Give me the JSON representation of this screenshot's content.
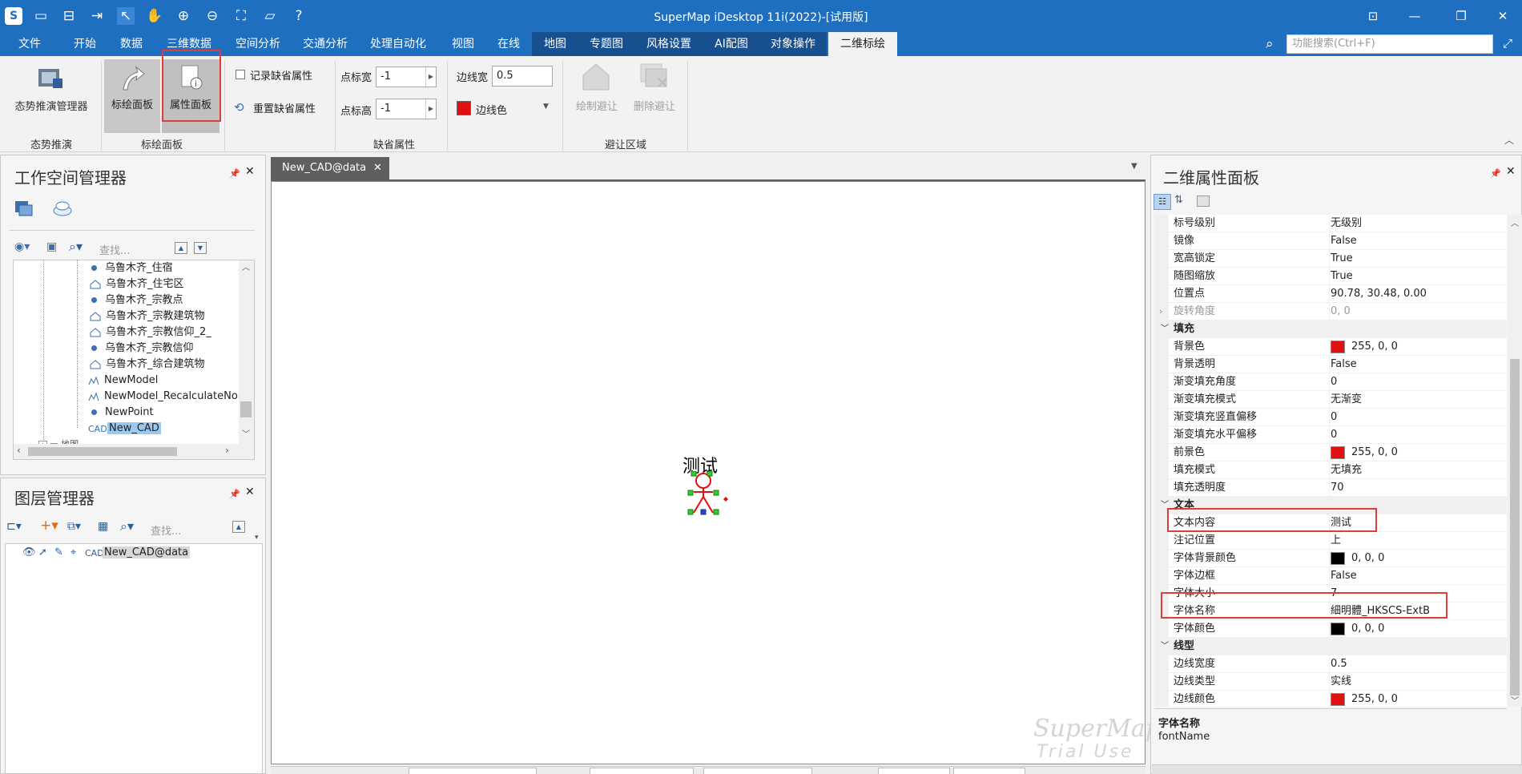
{
  "titlebar": {
    "title": "SuperMap iDesktop 11i(2022)-[试用版]"
  },
  "menubar": {
    "items": [
      "文件",
      "开始",
      "数据",
      "三维数据",
      "空间分析",
      "交通分析",
      "处理自动化",
      "视图",
      "在线",
      "地图",
      "专题图",
      "风格设置",
      "AI配图",
      "对象操作",
      "二维标绘"
    ],
    "search_placeholder": "功能搜索(Ctrl+F)"
  },
  "ribbon": {
    "situation_manager": "态势推演管理器",
    "group_situation": "态势推演",
    "plot_panel": "标绘面板",
    "attr_panel": "属性面板",
    "group_plot": "标绘面板",
    "record_default": "记录缺省属性",
    "reset_default": "重置缺省属性",
    "point_width_label": "点标宽",
    "point_width_value": "-1",
    "point_height_label": "点标高",
    "point_height_value": "-1",
    "line_width_label": "边线宽",
    "line_width_value": "0.5",
    "line_color_label": "边线色",
    "group_default": "缺省属性",
    "draw_avoid": "绘制避让",
    "delete_avoid": "删除避让",
    "group_avoid": "避让区域",
    "colors": {
      "red": "#e01010"
    }
  },
  "workspace": {
    "title": "工作空间管理器",
    "search_placeholder": "查找...",
    "items": [
      {
        "icon": "dot",
        "label": "乌鲁木齐_住宿"
      },
      {
        "icon": "region",
        "label": "乌鲁木齐_住宅区"
      },
      {
        "icon": "dot",
        "label": "乌鲁木齐_宗教点"
      },
      {
        "icon": "region",
        "label": "乌鲁木齐_宗教建筑物"
      },
      {
        "icon": "region",
        "label": "乌鲁木齐_宗教信仰_2_"
      },
      {
        "icon": "dot",
        "label": "乌鲁木齐_宗教信仰"
      },
      {
        "icon": "region",
        "label": "乌鲁木齐_综合建筑物"
      },
      {
        "icon": "model",
        "label": "NewModel"
      },
      {
        "icon": "model",
        "label": "NewModel_RecalculateNor"
      },
      {
        "icon": "dot",
        "label": "NewPoint"
      },
      {
        "icon": "cad",
        "label": "New_CAD"
      }
    ],
    "cut_item": "地图"
  },
  "layers": {
    "title": "图层管理器",
    "search_placeholder": "查找...",
    "layer_name": "New_CAD@data"
  },
  "map": {
    "tab": "New_CAD@data",
    "label_text": "测试",
    "watermark": [
      "SuperMap",
      "Trial Use"
    ]
  },
  "props": {
    "title": "二维属性面板",
    "rows": [
      {
        "k": "标号级别",
        "v": "无级别"
      },
      {
        "k": "镜像",
        "v": "False"
      },
      {
        "k": "宽高锁定",
        "v": "True"
      },
      {
        "k": "随图缩放",
        "v": "True"
      },
      {
        "k": "位置点",
        "v": "90.78, 30.48, 0.00"
      },
      {
        "k": "旋转角度",
        "v": "0, 0",
        "dim": true,
        "expand": true
      },
      {
        "cat": "填充"
      },
      {
        "k": "背景色",
        "v": "255, 0, 0",
        "swatch": "#e01010"
      },
      {
        "k": "背景透明",
        "v": "False"
      },
      {
        "k": "渐变填充角度",
        "v": "0"
      },
      {
        "k": "渐变填充模式",
        "v": "无渐变"
      },
      {
        "k": "渐变填充竖直偏移",
        "v": "0"
      },
      {
        "k": "渐变填充水平偏移",
        "v": "0"
      },
      {
        "k": "前景色",
        "v": "255, 0, 0",
        "swatch": "#e01010"
      },
      {
        "k": "填充模式",
        "v": "无填充"
      },
      {
        "k": "填充透明度",
        "v": "70"
      },
      {
        "cat": "文本"
      },
      {
        "k": "文本内容",
        "v": "测试"
      },
      {
        "k": "注记位置",
        "v": "上"
      },
      {
        "k": "字体背景颜色",
        "v": "0, 0, 0",
        "swatch": "#000000"
      },
      {
        "k": "字体边框",
        "v": "False"
      },
      {
        "k": "字体大小",
        "v": "7"
      },
      {
        "k": "字体名称",
        "v": "細明體_HKSCS-ExtB"
      },
      {
        "k": "字体颜色",
        "v": "0, 0, 0",
        "swatch": "#000000"
      },
      {
        "cat": "线型"
      },
      {
        "k": "边线宽度",
        "v": "0.5"
      },
      {
        "k": "边线类型",
        "v": "实线"
      },
      {
        "k": "边线颜色",
        "v": "255, 0, 0",
        "swatch": "#e01010"
      }
    ],
    "desc_title": "字体名称",
    "desc_body": "fontName"
  }
}
